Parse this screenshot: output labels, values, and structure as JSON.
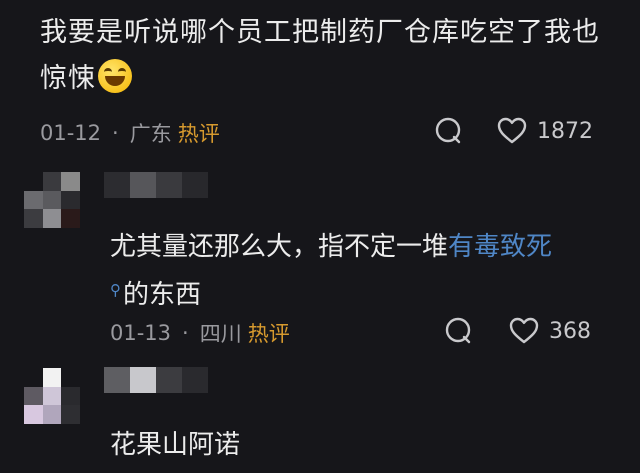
{
  "comments": [
    {
      "text": "我要是听说哪个员工把制药厂仓库吃空了我也惊悚",
      "emoji": "grinning-face-emoji",
      "date": "01-12",
      "separator": "·",
      "location": "广东",
      "badge": "热评",
      "likes": "1872"
    },
    {
      "text_before": "尤其量还那么大，指不定一堆",
      "link_text": "有毒致死",
      "search_mark": "⚲",
      "text_after": "的东西",
      "date": "01-13",
      "separator": "·",
      "location": "四川",
      "badge": "热评",
      "likes": "368"
    },
    {
      "text": "花果山阿诺"
    }
  ],
  "colors": {
    "background": "#16161a",
    "hot_badge": "#d79a2e",
    "link": "#4f86c6"
  }
}
